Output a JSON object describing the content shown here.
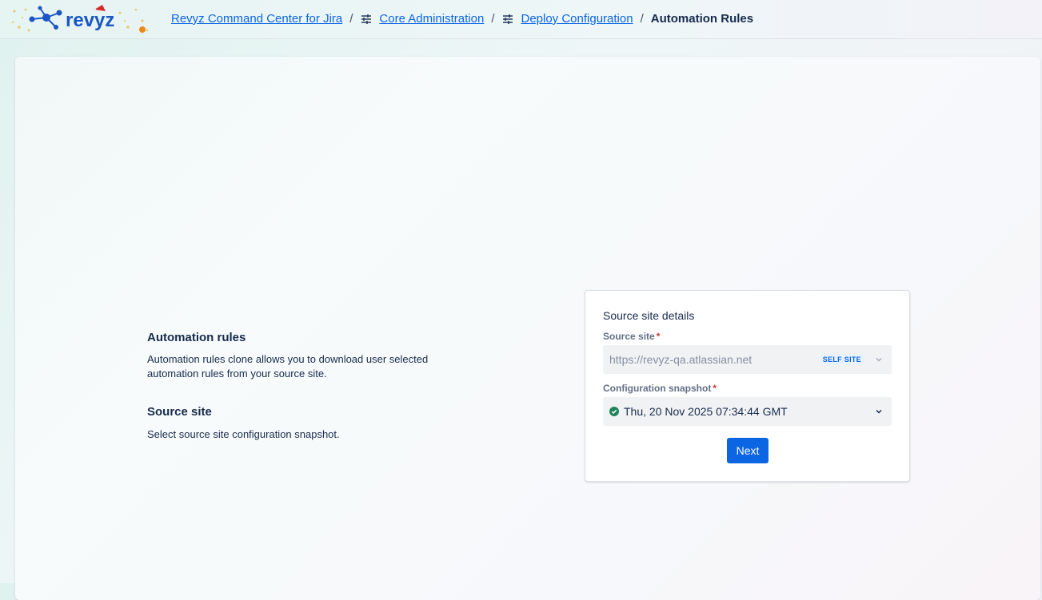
{
  "header": {
    "logo_text": "revyz",
    "breadcrumbs": [
      {
        "label": "Revyz Command Center for Jira"
      },
      {
        "label": "Core Administration"
      },
      {
        "label": "Deploy Configuration"
      },
      {
        "label": "Automation Rules"
      }
    ],
    "separator": "/"
  },
  "info": {
    "title": "Automation rules",
    "description": "Automation rules clone allows you to download user selected automation rules from your source site.",
    "source_title": "Source site",
    "source_description": "Select source site configuration snapshot."
  },
  "form": {
    "heading": "Source site details",
    "source_site": {
      "label": "Source site",
      "required_mark": "*",
      "value": "https://revyz-qa.atlassian.net",
      "badge": "SELF SITE"
    },
    "snapshot": {
      "label": "Configuration snapshot",
      "required_mark": "*",
      "value": "Thu, 20 Nov 2025 07:34:44 GMT"
    },
    "next_label": "Next"
  },
  "colors": {
    "accent": "#0c66e4",
    "success": "#1f845a",
    "required": "#c9372c"
  }
}
